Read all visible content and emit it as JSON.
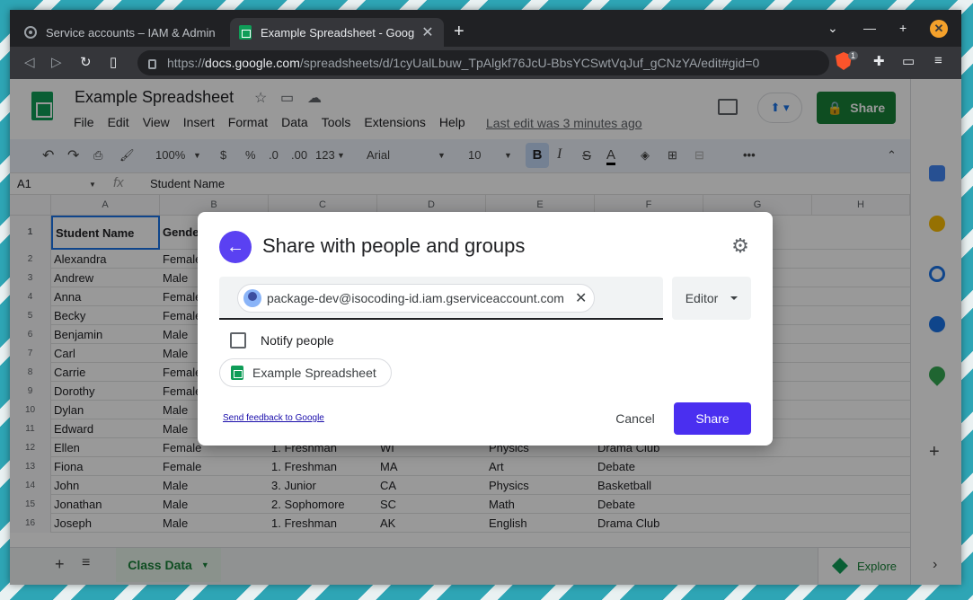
{
  "browser": {
    "tabs": [
      {
        "title": "Service accounts – IAM & Admin"
      },
      {
        "title": "Example Spreadsheet - Goog"
      }
    ],
    "url_prefix": "https://",
    "url_host": "docs.google.com",
    "url_path": "/spreadsheets/d/1cyUalLbuw_TpAlgkf76JcU-BbsYCSwtVqJuf_gCNzYA/edit#gid=0",
    "brave_badge": "1"
  },
  "doc": {
    "title": "Example Spreadsheet",
    "menu": [
      "File",
      "Edit",
      "View",
      "Insert",
      "Format",
      "Data",
      "Tools",
      "Extensions",
      "Help"
    ],
    "last_edit": "Last edit was 3 minutes ago",
    "share_label": "Share"
  },
  "format_bar": {
    "zoom": "100%",
    "currency": "$",
    "percent": "%",
    "dec_less": ".0",
    "dec_more": ".00",
    "more_formats": "123",
    "font": "Arial",
    "font_size": "10",
    "bold": "B",
    "italic": "I",
    "strike": "S",
    "text_color": "A"
  },
  "formula_bar": {
    "cell": "A1",
    "fx": "fx",
    "value": "Student Name"
  },
  "grid": {
    "columns": [
      "A",
      "B",
      "C",
      "D",
      "E",
      "F",
      "G",
      "H"
    ],
    "header_row": {
      "num": "1",
      "a": "Student Name",
      "b": "Gende"
    },
    "rows": [
      {
        "num": "2",
        "a": "Alexandra",
        "b": "Female",
        "c": "",
        "d": "",
        "e": "",
        "f": ""
      },
      {
        "num": "3",
        "a": "Andrew",
        "b": "Male",
        "c": "",
        "d": "",
        "e": "",
        "f": ""
      },
      {
        "num": "4",
        "a": "Anna",
        "b": "Female",
        "c": "",
        "d": "",
        "e": "",
        "f": ""
      },
      {
        "num": "5",
        "a": "Becky",
        "b": "Female",
        "c": "",
        "d": "",
        "e": "",
        "f": ""
      },
      {
        "num": "6",
        "a": "Benjamin",
        "b": "Male",
        "c": "",
        "d": "",
        "e": "",
        "f": ""
      },
      {
        "num": "7",
        "a": "Carl",
        "b": "Male",
        "c": "",
        "d": "",
        "e": "",
        "f": ""
      },
      {
        "num": "8",
        "a": "Carrie",
        "b": "Female",
        "c": "",
        "d": "",
        "e": "",
        "f": ""
      },
      {
        "num": "9",
        "a": "Dorothy",
        "b": "Female",
        "c": "",
        "d": "",
        "e": "",
        "f": ""
      },
      {
        "num": "10",
        "a": "Dylan",
        "b": "Male",
        "c": "",
        "d": "",
        "e": "",
        "f": ""
      },
      {
        "num": "11",
        "a": "Edward",
        "b": "Male",
        "c": "",
        "d": "",
        "e": "",
        "f": ""
      },
      {
        "num": "12",
        "a": "Ellen",
        "b": "Female",
        "c": "1. Freshman",
        "d": "WI",
        "e": "Physics",
        "f": "Drama Club"
      },
      {
        "num": "13",
        "a": "Fiona",
        "b": "Female",
        "c": "1. Freshman",
        "d": "MA",
        "e": "Art",
        "f": "Debate"
      },
      {
        "num": "14",
        "a": "John",
        "b": "Male",
        "c": "3. Junior",
        "d": "CA",
        "e": "Physics",
        "f": "Basketball"
      },
      {
        "num": "15",
        "a": "Jonathan",
        "b": "Male",
        "c": "2. Sophomore",
        "d": "SC",
        "e": "Math",
        "f": "Debate"
      },
      {
        "num": "16",
        "a": "Joseph",
        "b": "Male",
        "c": "1. Freshman",
        "d": "AK",
        "e": "English",
        "f": "Drama Club"
      }
    ]
  },
  "sheet_bar": {
    "sheet_name": "Class Data",
    "explore": "Explore"
  },
  "dialog": {
    "title": "Share with people and groups",
    "recipient": "package-dev@isocoding-id.iam.gserviceaccount.com",
    "role": "Editor",
    "notify_label": "Notify people",
    "file_name": "Example Spreadsheet",
    "feedback_link": "Send feedback to Google",
    "cancel_label": "Cancel",
    "share_label": "Share"
  },
  "colors": {
    "accent": "#4a2ff0",
    "sheets_green": "#0f9d58",
    "share_green": "#188038"
  }
}
